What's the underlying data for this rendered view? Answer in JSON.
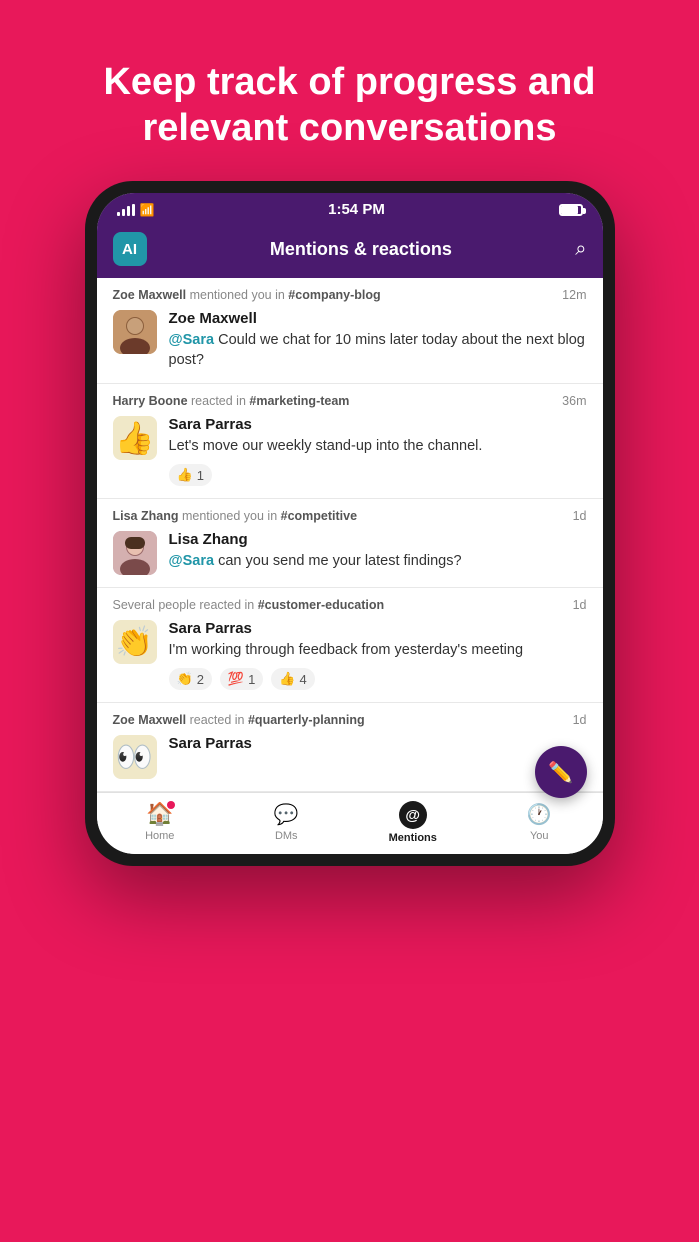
{
  "hero": {
    "line1": "Keep track of progress and",
    "line2": "relevant conversations"
  },
  "statusBar": {
    "time": "1:54 PM"
  },
  "header": {
    "aiLabel": "AI",
    "title": "Mentions & reactions"
  },
  "feedItems": [
    {
      "id": "item1",
      "meta": "Zoe Maxwell mentioned you in #company-blog",
      "metaName": "Zoe Maxwell",
      "metaChannel": "#company-blog",
      "time": "12m",
      "author": "Zoe Maxwell",
      "message": "@Sara Could we chat for 10 mins later today about the next blog post?",
      "mention": "@Sara",
      "avatarEmoji": "👩",
      "avatarColor": "#c8a87a",
      "reactions": []
    },
    {
      "id": "item2",
      "meta": "Harry Boone reacted in #marketing-team",
      "metaName": "Harry Boone",
      "metaChannel": "#marketing-team",
      "time": "36m",
      "author": "Sara Parras",
      "message": "Let's move our weekly stand-up into the channel.",
      "mention": "",
      "avatarEmoji": "👍",
      "avatarColor": "#f5e6a0",
      "reactions": [
        {
          "emoji": "👍",
          "count": "1"
        }
      ]
    },
    {
      "id": "item3",
      "meta": "Lisa Zhang mentioned you in #competitive",
      "metaName": "Lisa Zhang",
      "metaChannel": "#competitive",
      "time": "1d",
      "author": "Lisa Zhang",
      "message": "@Sara can you send me your latest findings?",
      "mention": "@Sara",
      "avatarEmoji": "👩",
      "avatarColor": "#d4a0a0",
      "reactions": []
    },
    {
      "id": "item4",
      "meta": "Several people reacted in #customer-education",
      "metaName": "Several people",
      "metaChannel": "#customer-education",
      "time": "1d",
      "author": "Sara Parras",
      "message": "I'm working through feedback from yesterday's meeting",
      "mention": "",
      "avatarEmoji": "👏",
      "avatarColor": "#f5e6a0",
      "reactions": [
        {
          "emoji": "👏",
          "count": "2"
        },
        {
          "emoji": "💯",
          "count": "1"
        },
        {
          "emoji": "👍",
          "count": "4"
        }
      ]
    },
    {
      "id": "item5",
      "meta": "Zoe Maxwell reacted in #quarterly-planning",
      "metaName": "Zoe Maxwell",
      "metaChannel": "#quarterly-planning",
      "time": "1d",
      "author": "Sara Parras",
      "message": "",
      "mention": "",
      "avatarEmoji": "👀",
      "avatarColor": "#f5e6a0",
      "reactions": []
    }
  ],
  "tabs": [
    {
      "id": "home",
      "label": "Home",
      "icon": "🏠",
      "active": false
    },
    {
      "id": "dms",
      "label": "DMs",
      "icon": "💬",
      "active": false
    },
    {
      "id": "mentions",
      "label": "Mentions",
      "icon": "@",
      "active": true
    },
    {
      "id": "you",
      "label": "You",
      "icon": "🕐",
      "active": false
    }
  ],
  "fab": {
    "icon": "✏️"
  }
}
